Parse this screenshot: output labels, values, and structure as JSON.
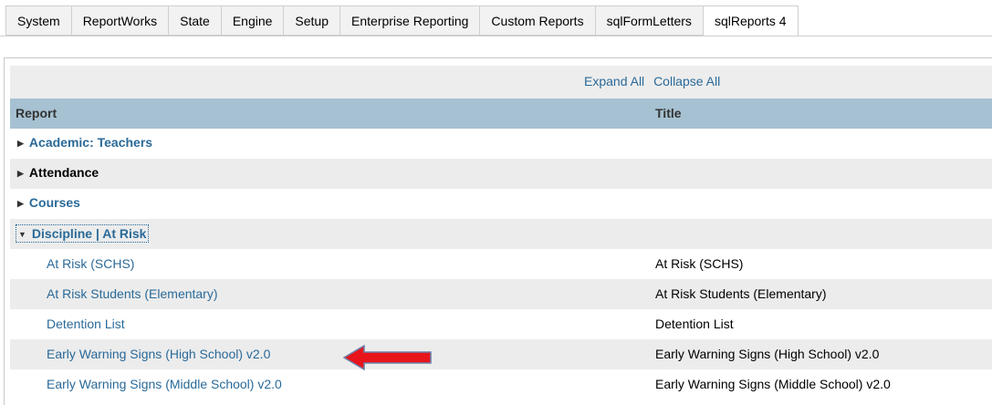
{
  "tabs": [
    {
      "label": "System"
    },
    {
      "label": "ReportWorks"
    },
    {
      "label": "State"
    },
    {
      "label": "Engine"
    },
    {
      "label": "Setup"
    },
    {
      "label": "Enterprise Reporting"
    },
    {
      "label": "Custom Reports"
    },
    {
      "label": "sqlFormLetters"
    },
    {
      "label": "sqlReports 4",
      "active": true
    }
  ],
  "toolbar": {
    "expand_all": "Expand All",
    "collapse_all": "Collapse All"
  },
  "table": {
    "col_report": "Report",
    "col_title": "Title",
    "groups": [
      {
        "label": "Academic: Teachers",
        "expanded": false
      },
      {
        "label": "Attendance",
        "expanded": false
      },
      {
        "label": "Courses",
        "expanded": false
      },
      {
        "label": "Discipline | At Risk",
        "expanded": true
      }
    ],
    "reports": [
      {
        "name": "At Risk (SCHS)",
        "title": "At Risk (SCHS)"
      },
      {
        "name": "At Risk Students (Elementary)",
        "title": "At Risk Students (Elementary)"
      },
      {
        "name": "Detention List",
        "title": "Detention List"
      },
      {
        "name": "Early Warning Signs (High School) v2.0",
        "title": "Early Warning Signs (High School) v2.0"
      },
      {
        "name": "Early Warning Signs (Middle School) v2.0",
        "title": "Early Warning Signs (Middle School) v2.0"
      }
    ]
  },
  "colors": {
    "link": "#2a6a99",
    "header_bg": "#a6c1d1",
    "arrow": "#e8141c"
  },
  "icons": {
    "collapsed": "triangle-right-icon",
    "expanded": "triangle-down-icon",
    "pointer": "red-arrow-icon"
  }
}
